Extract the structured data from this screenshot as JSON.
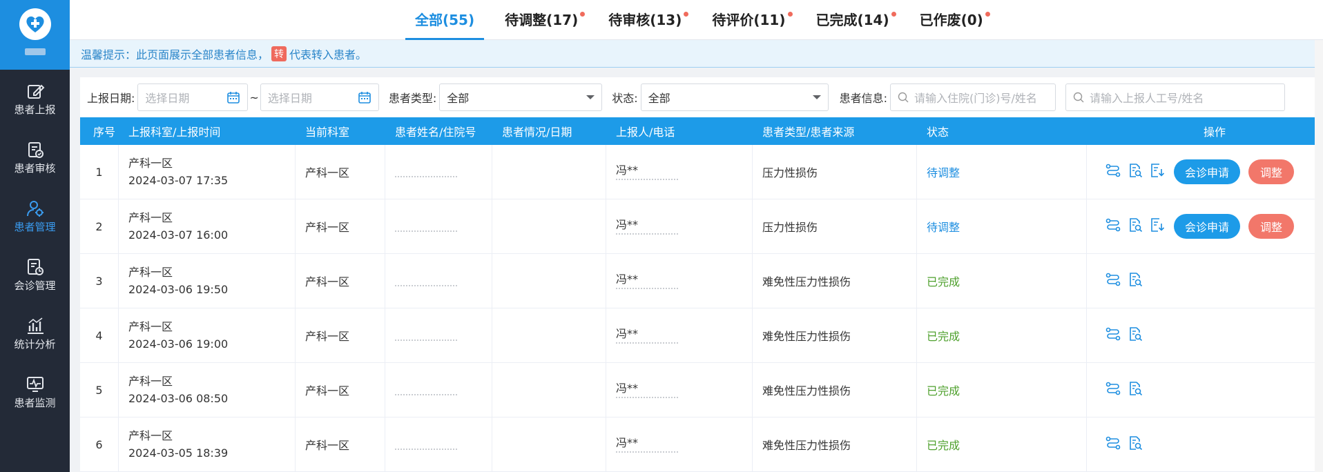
{
  "sidebar": {
    "items": [
      {
        "label": "患者上报",
        "icon": "edit-icon"
      },
      {
        "label": "患者审核",
        "icon": "clipboard-check-icon"
      },
      {
        "label": "患者管理",
        "icon": "user-settings-icon",
        "active": true
      },
      {
        "label": "会诊管理",
        "icon": "consult-clock-icon"
      },
      {
        "label": "统计分析",
        "icon": "bar-chart-icon"
      },
      {
        "label": "患者监测",
        "icon": "monitor-pulse-icon"
      }
    ]
  },
  "tabs": [
    {
      "label": "全部(55)",
      "active": true,
      "dot": false
    },
    {
      "label": "待调整(17)",
      "dot": true
    },
    {
      "label": "待审核(13)",
      "dot": true
    },
    {
      "label": "待评价(11)",
      "dot": true
    },
    {
      "label": "已完成(14)",
      "dot": true
    },
    {
      "label": "已作废(0)",
      "dot": true
    }
  ],
  "hint": {
    "prefix": "温馨提示：此页面展示全部患者信息，",
    "badge": "转",
    "suffix": "代表转入患者。"
  },
  "filter": {
    "date_label": "上报日期:",
    "date_start_placeholder": "选择日期",
    "date_sep": "~",
    "date_end_placeholder": "选择日期",
    "type_label": "患者类型:",
    "type_value": "全部",
    "status_label": "状态:",
    "status_value": "全部",
    "info_label": "患者信息:",
    "info_placeholder": "请输入住院(门诊)号/姓名",
    "reporter_placeholder": "请输入上报人工号/姓名"
  },
  "table": {
    "headers": [
      "序号",
      "上报科室/上报时间",
      "当前科室",
      "患者姓名/住院号",
      "患者情况/日期",
      "上报人/电话",
      "患者类型/患者来源",
      "状态",
      "操作"
    ],
    "rows": [
      {
        "no": "1",
        "dept": "产科一区",
        "time": "2024-03-07 17:35",
        "current": "产科一区",
        "reporter": "冯**",
        "type": "压力性损伤",
        "status": "待调整",
        "status_kind": "pending",
        "full": true
      },
      {
        "no": "2",
        "dept": "产科一区",
        "time": "2024-03-07 16:00",
        "current": "产科一区",
        "reporter": "冯**",
        "type": "压力性损伤",
        "status": "待调整",
        "status_kind": "pending",
        "full": true
      },
      {
        "no": "3",
        "dept": "产科一区",
        "time": "2024-03-06 19:50",
        "current": "产科一区",
        "reporter": "冯**",
        "type": "难免性压力性损伤",
        "status": "已完成",
        "status_kind": "done",
        "full": false
      },
      {
        "no": "4",
        "dept": "产科一区",
        "time": "2024-03-06 19:00",
        "current": "产科一区",
        "reporter": "冯**",
        "type": "难免性压力性损伤",
        "status": "已完成",
        "status_kind": "done",
        "full": false
      },
      {
        "no": "5",
        "dept": "产科一区",
        "time": "2024-03-06 08:50",
        "current": "产科一区",
        "reporter": "冯**",
        "type": "难免性压力性损伤",
        "status": "已完成",
        "status_kind": "done",
        "full": false
      },
      {
        "no": "6",
        "dept": "产科一区",
        "time": "2024-03-05 18:39",
        "current": "产科一区",
        "reporter": "冯**",
        "type": "难免性压力性损伤",
        "status": "已完成",
        "status_kind": "done",
        "full": false
      }
    ],
    "btn_consult": "会诊申请",
    "btn_adjust": "调整"
  },
  "colors": {
    "primary": "#1d9be8",
    "danger": "#f2776a",
    "done": "#4ea02c",
    "sidebar": "#232a37"
  }
}
